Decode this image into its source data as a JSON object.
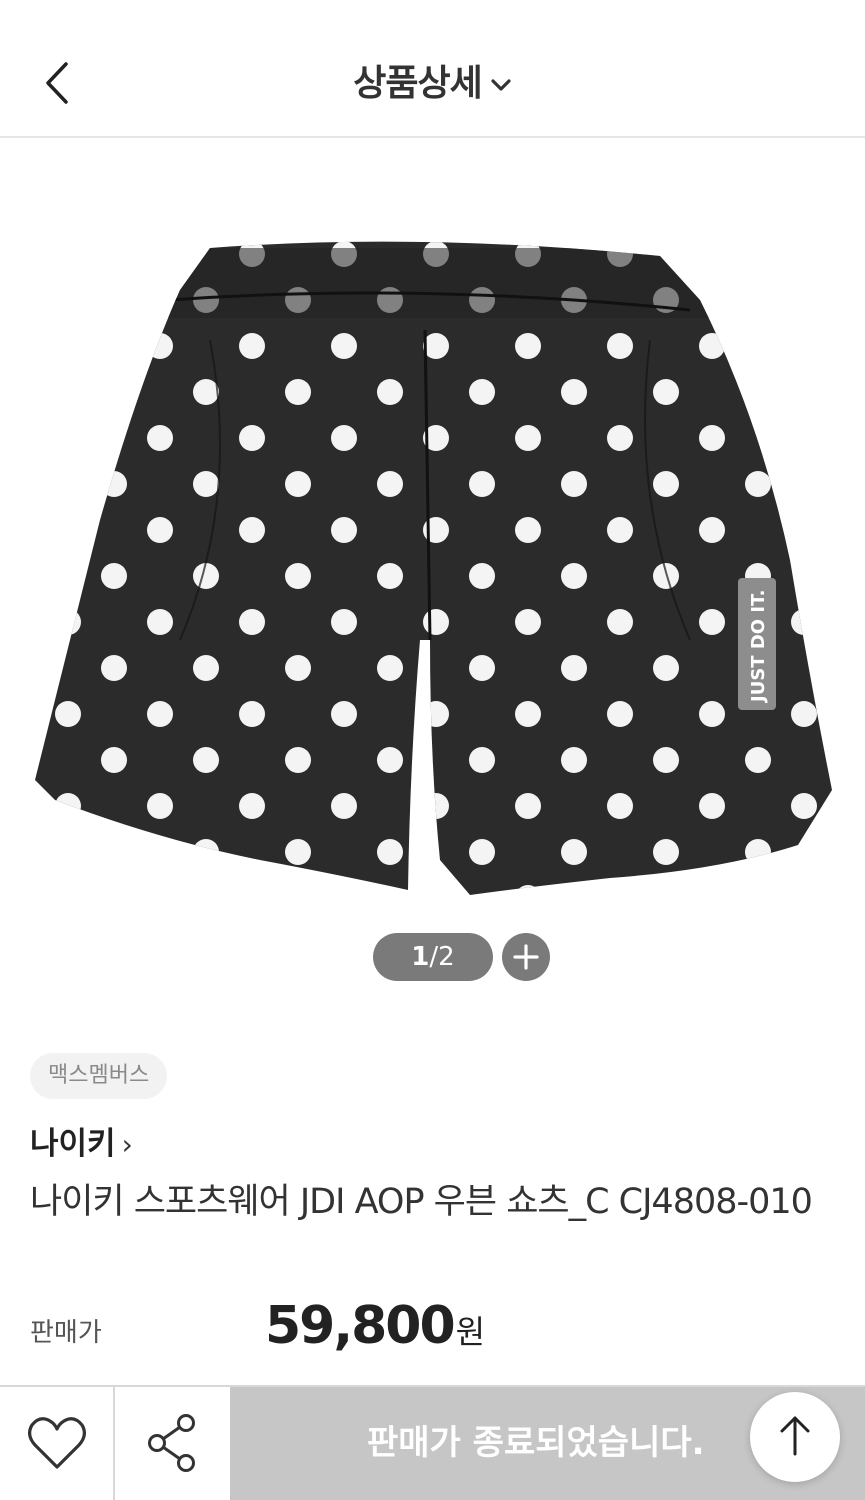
{
  "header": {
    "title": "상품상세",
    "back_icon": "chevron-left-icon",
    "dropdown_icon": "chevron-down-icon"
  },
  "gallery": {
    "current": "1",
    "separator": "/",
    "total": "2",
    "zoom_icon": "plus-icon",
    "logo_text": "JUST DO IT."
  },
  "product": {
    "badge": "맥스멤버스",
    "brand": "나이키",
    "brand_arrow": "›",
    "name": "나이키 스포츠웨어 JDI AOP 우븐 쇼츠_C CJ4808-010",
    "price_label": "판매가",
    "price": "59,800",
    "currency": "원"
  },
  "bottom_bar": {
    "wish_icon": "heart-icon",
    "share_icon": "share-icon",
    "status": "판매가 종료되었습니다.",
    "top_icon": "arrow-up-icon",
    "status_bg": "#c6c6c6"
  }
}
